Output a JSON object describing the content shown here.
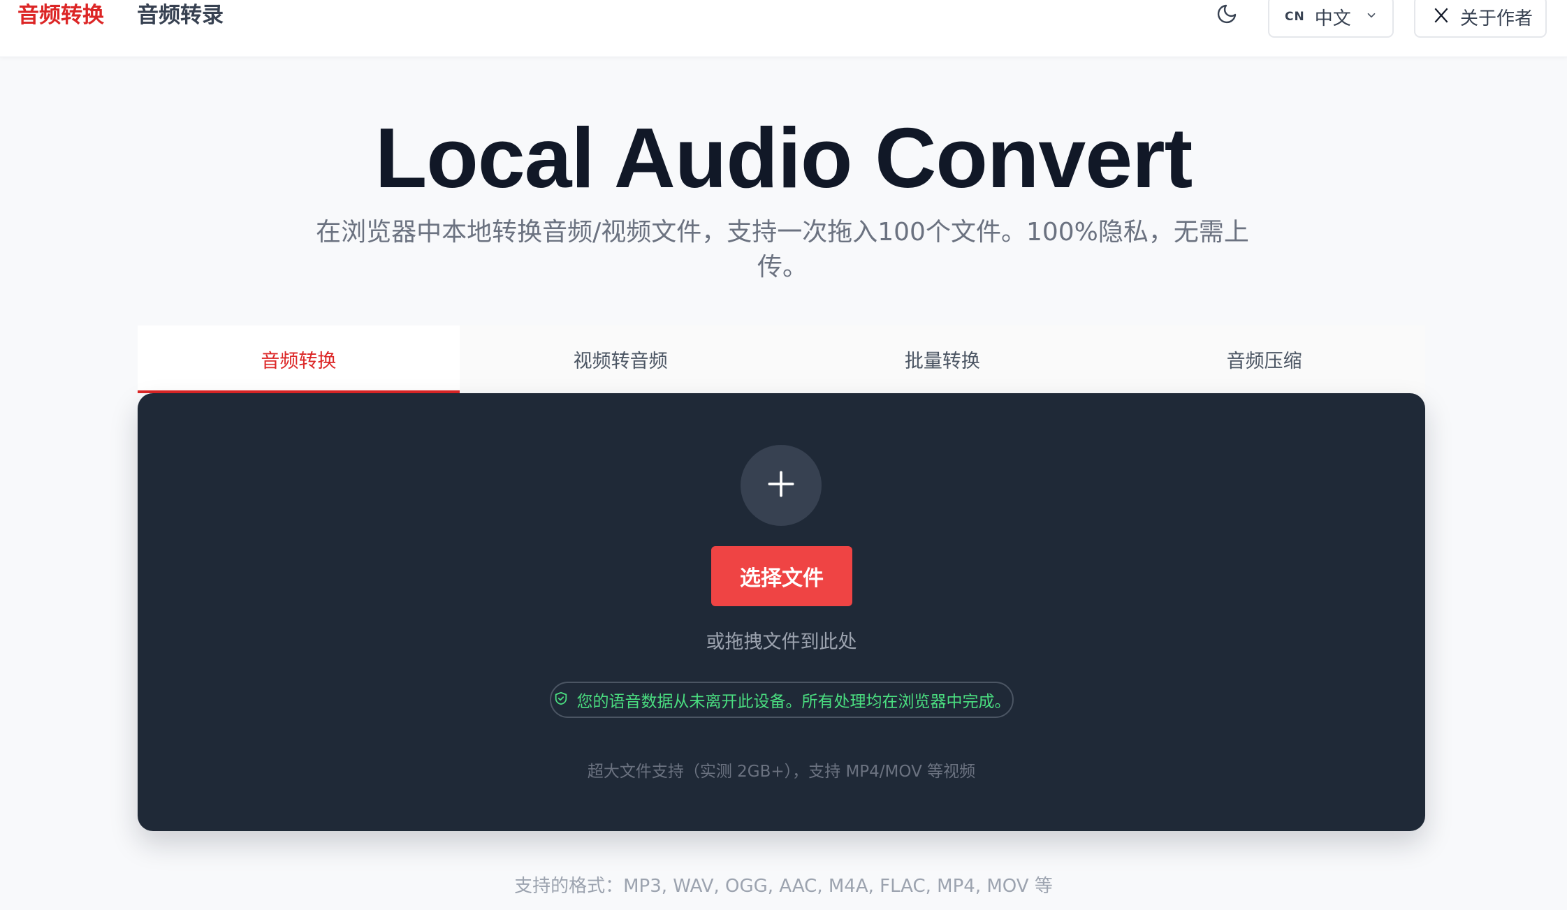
{
  "nav": {
    "convert_label": "音频转换",
    "transcribe_label": "音频转录",
    "theme_icon": "moon-icon",
    "lang_code": "CN",
    "lang_name": "中文",
    "about_label": "关于作者",
    "about_icon": "x-logo-icon"
  },
  "hero": {
    "title": "Local Audio Convert",
    "subtitle": "在浏览器中本地转换音频/视频文件，支持一次拖入100个文件。100%隐私，无需上传。"
  },
  "tabs": [
    {
      "label": "音频转换",
      "active": true
    },
    {
      "label": "视频转音频",
      "active": false
    },
    {
      "label": "批量转换",
      "active": false
    },
    {
      "label": "音频压缩",
      "active": false
    }
  ],
  "dropzone": {
    "add_icon": "plus-icon",
    "choose_label": "选择文件",
    "drag_hint": "或拖拽文件到此处",
    "privacy_icon": "shield-check-icon",
    "privacy_text": "您的语音数据从未离开此设备。所有处理均在浏览器中完成。",
    "size_note": "超大文件支持（实测 2GB+），支持 MP4/MOV 等视频"
  },
  "formats_text": "支持的格式：MP3, WAV, OGG, AAC, M4A, FLAC, MP4, MOV 等",
  "colors": {
    "accent": "#dc2626",
    "button": "#ef4444",
    "panel": "#1f2937",
    "privacy_green": "#4ade80"
  }
}
